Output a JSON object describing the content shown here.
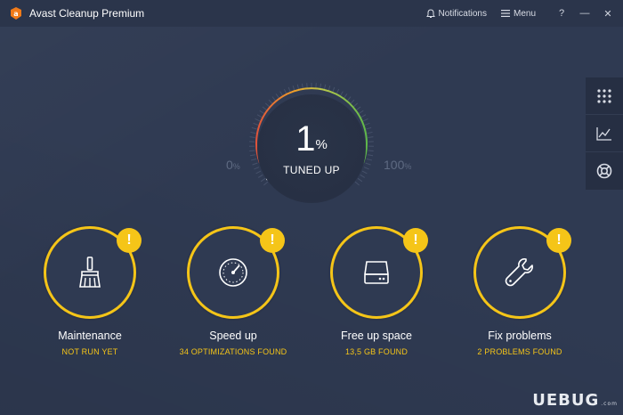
{
  "app": {
    "title": "Avast Cleanup Premium"
  },
  "titlebar": {
    "notifications_label": "Notifications",
    "menu_label": "Menu",
    "help_label": "?",
    "minimize_label": "—",
    "close_label": "✕"
  },
  "side_panel": {
    "items": [
      {
        "icon": "grid-icon"
      },
      {
        "icon": "chart-icon"
      },
      {
        "icon": "lifebuoy-icon"
      }
    ]
  },
  "gauge": {
    "value": "1",
    "unit": "%",
    "level": 0.01,
    "label": "TUNED UP",
    "min_label": "0",
    "min_unit": "%",
    "max_label": "100",
    "max_unit": "%"
  },
  "cards": [
    {
      "title": "Maintenance",
      "status": "NOT RUN YET",
      "icon": "broom-icon",
      "alert": "!"
    },
    {
      "title": "Speed up",
      "status": "34 OPTIMIZATIONS FOUND",
      "icon": "speedometer-icon",
      "alert": "!"
    },
    {
      "title": "Free up space",
      "status": "13,5 GB FOUND",
      "icon": "hard-drive-icon",
      "alert": "!"
    },
    {
      "title": "Fix problems",
      "status": "2 PROBLEMS FOUND",
      "icon": "wrench-icon",
      "alert": "!"
    }
  ],
  "watermark": {
    "main": "UEBUG",
    "sub": ".com"
  },
  "colors": {
    "background": "#2f3a52",
    "titlebar": "#2b354b",
    "accent": "#f5c518",
    "muted": "#5e6a82",
    "logo": "#f07a19"
  }
}
